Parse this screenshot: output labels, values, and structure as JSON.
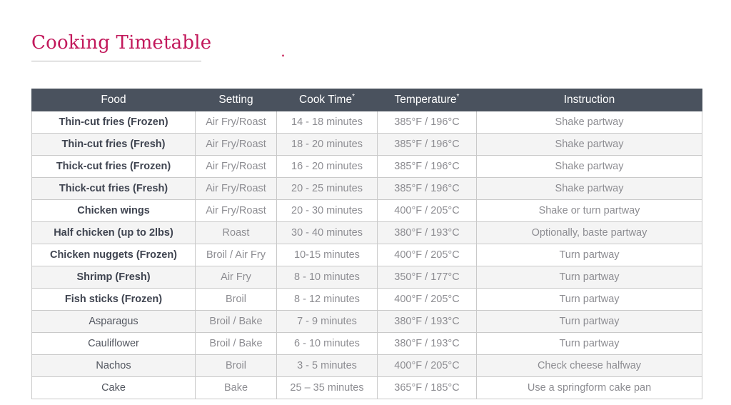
{
  "title": "Cooking Timetable",
  "title_dot": ".",
  "accent_color": "#c2185b",
  "header_bg_color": "#4a525e",
  "stripe_color": "#f4f4f4",
  "table": {
    "columns": [
      {
        "label": "Food",
        "sup": ""
      },
      {
        "label": "Setting",
        "sup": ""
      },
      {
        "label": "Cook Time",
        "sup": "*"
      },
      {
        "label": "Temperature",
        "sup": "*"
      },
      {
        "label": "Instruction",
        "sup": ""
      }
    ],
    "rows": [
      {
        "food": "Thin-cut fries (Frozen)",
        "setting": "Air Fry/Roast",
        "cook_time": "14 - 18 minutes",
        "temperature": "385°F / 196°C",
        "instruction": "Shake partway",
        "bold_name": true
      },
      {
        "food": "Thin-cut fries (Fresh)",
        "setting": "Air Fry/Roast",
        "cook_time": "18 - 20 minutes",
        "temperature": "385°F / 196°C",
        "instruction": "Shake partway",
        "bold_name": true
      },
      {
        "food": "Thick-cut fries (Frozen)",
        "setting": "Air Fry/Roast",
        "cook_time": "16 - 20 minutes",
        "temperature": "385°F / 196°C",
        "instruction": "Shake partway",
        "bold_name": true
      },
      {
        "food": "Thick-cut fries (Fresh)",
        "setting": "Air Fry/Roast",
        "cook_time": "20 - 25 minutes",
        "temperature": "385°F / 196°C",
        "instruction": "Shake partway",
        "bold_name": true
      },
      {
        "food": "Chicken wings",
        "setting": "Air Fry/Roast",
        "cook_time": "20 - 30 minutes",
        "temperature": "400°F / 205°C",
        "instruction": "Shake or turn partway",
        "bold_name": true
      },
      {
        "food": "Half chicken (up to 2lbs)",
        "setting": "Roast",
        "cook_time": "30 - 40 minutes",
        "temperature": "380°F / 193°C",
        "instruction": "Optionally, baste partway",
        "bold_name": true
      },
      {
        "food": "Chicken nuggets (Frozen)",
        "setting": "Broil / Air Fry",
        "cook_time": "10-15 minutes",
        "temperature": "400°F / 205°C",
        "instruction": "Turn partway",
        "bold_name": true
      },
      {
        "food": "Shrimp (Fresh)",
        "setting": "Air Fry",
        "cook_time": "8 - 10 minutes",
        "temperature": "350°F / 177°C",
        "instruction": "Turn partway",
        "bold_name": true
      },
      {
        "food": "Fish sticks (Frozen)",
        "setting": "Broil",
        "cook_time": "8 - 12 minutes",
        "temperature": "400°F / 205°C",
        "instruction": "Turn partway",
        "bold_name": true
      },
      {
        "food": "Asparagus",
        "setting": "Broil / Bake",
        "cook_time": "7 - 9 minutes",
        "temperature": "380°F / 193°C",
        "instruction": "Turn partway",
        "bold_name": false
      },
      {
        "food": "Cauliflower",
        "setting": "Broil / Bake",
        "cook_time": "6 - 10 minutes",
        "temperature": "380°F / 193°C",
        "instruction": "Turn partway",
        "bold_name": false
      },
      {
        "food": "Nachos",
        "setting": "Broil",
        "cook_time": "3 - 5 minutes",
        "temperature": "400°F / 205°C",
        "instruction": "Check cheese halfway",
        "bold_name": false
      },
      {
        "food": "Cake",
        "setting": "Bake",
        "cook_time": "25 – 35 minutes",
        "temperature": "365°F / 185°C",
        "instruction": "Use a springform cake pan",
        "bold_name": false
      }
    ]
  }
}
